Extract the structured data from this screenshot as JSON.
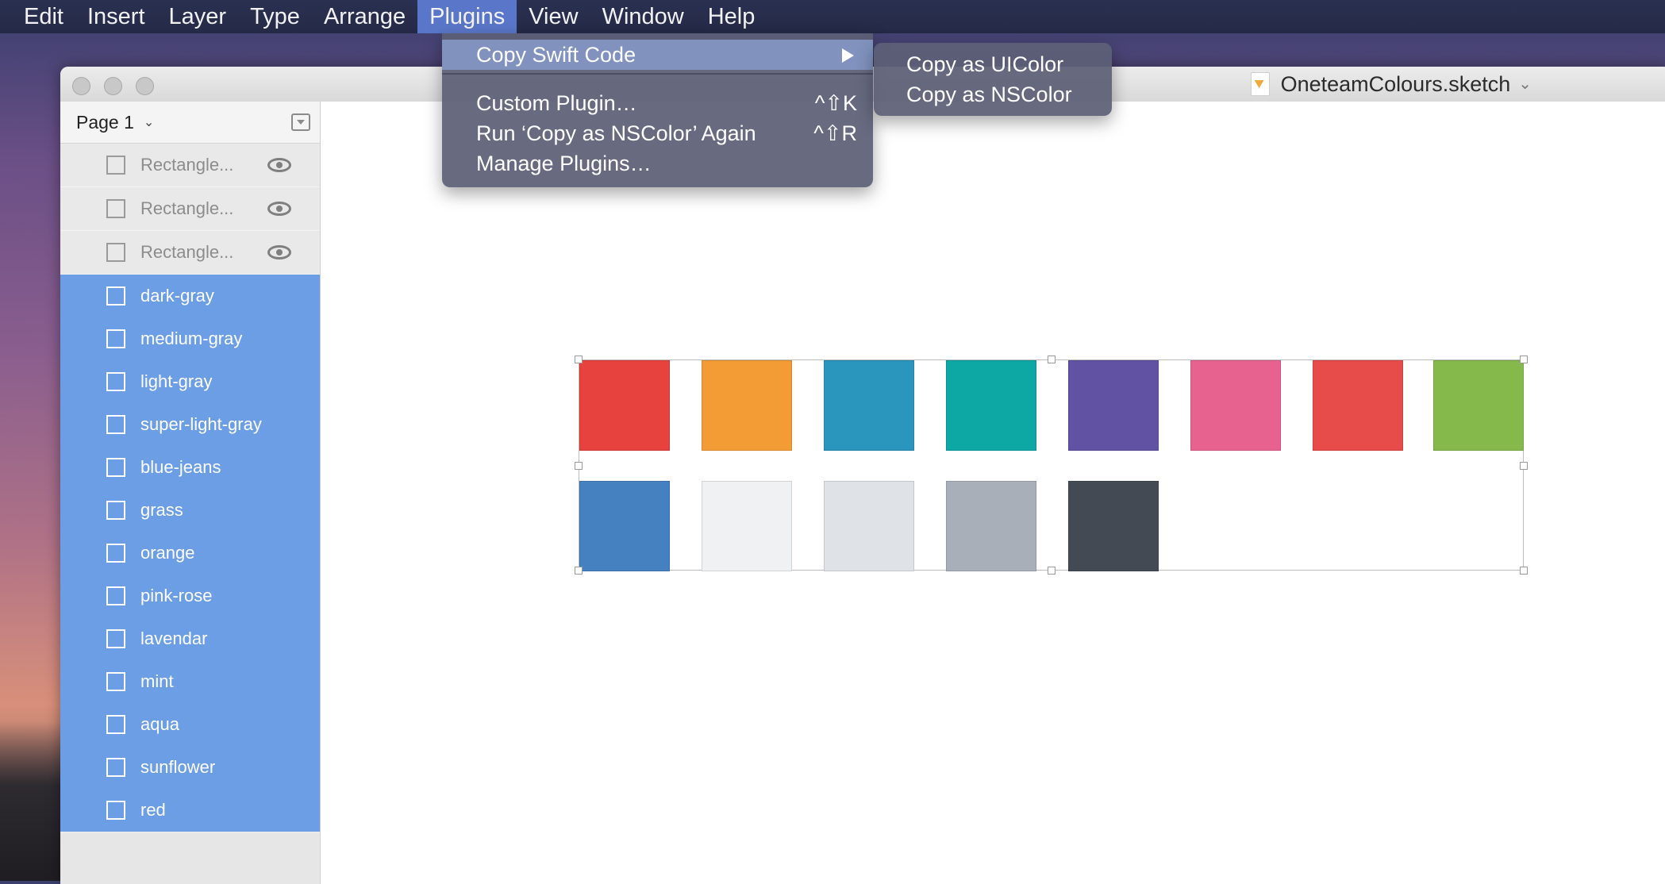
{
  "menubar": {
    "items": [
      "Edit",
      "Insert",
      "Layer",
      "Type",
      "Arrange",
      "Plugins",
      "View",
      "Window",
      "Help"
    ],
    "active": "Plugins"
  },
  "window": {
    "document_title": "OneteamColours.sketch"
  },
  "sidebar": {
    "page_label": "Page 1",
    "layers_dim": [
      "Rectangle...",
      "Rectangle...",
      "Rectangle..."
    ],
    "layers_selected": [
      "dark-gray",
      "medium-gray",
      "light-gray",
      "super-light-gray",
      "blue-jeans",
      "grass",
      "orange",
      "pink-rose",
      "lavendar",
      "mint",
      "aqua",
      "sunflower",
      "red"
    ]
  },
  "plugins_menu": {
    "items": [
      {
        "label": "Copy Swift Code",
        "shortcut": "",
        "has_submenu": true
      },
      {
        "label": "Custom Plugin…",
        "shortcut": "^⇧K"
      },
      {
        "label": "Run ‘Copy as NSColor’ Again",
        "shortcut": "^⇧R"
      },
      {
        "label": "Manage Plugins…",
        "shortcut": ""
      }
    ]
  },
  "submenu": {
    "items": [
      "Copy as UIColor",
      "Copy as NSColor"
    ]
  },
  "swatches": {
    "row1": [
      "#e8423e",
      "#f39b34",
      "#2a96bd",
      "#0da7a4",
      "#6252a3",
      "#e8628f",
      "#e84c4a",
      "#86b94c"
    ],
    "row2": [
      "#4580c1",
      "#f0f1f3",
      "#dfe2e7",
      "#a9afb8",
      "#434a53"
    ]
  }
}
